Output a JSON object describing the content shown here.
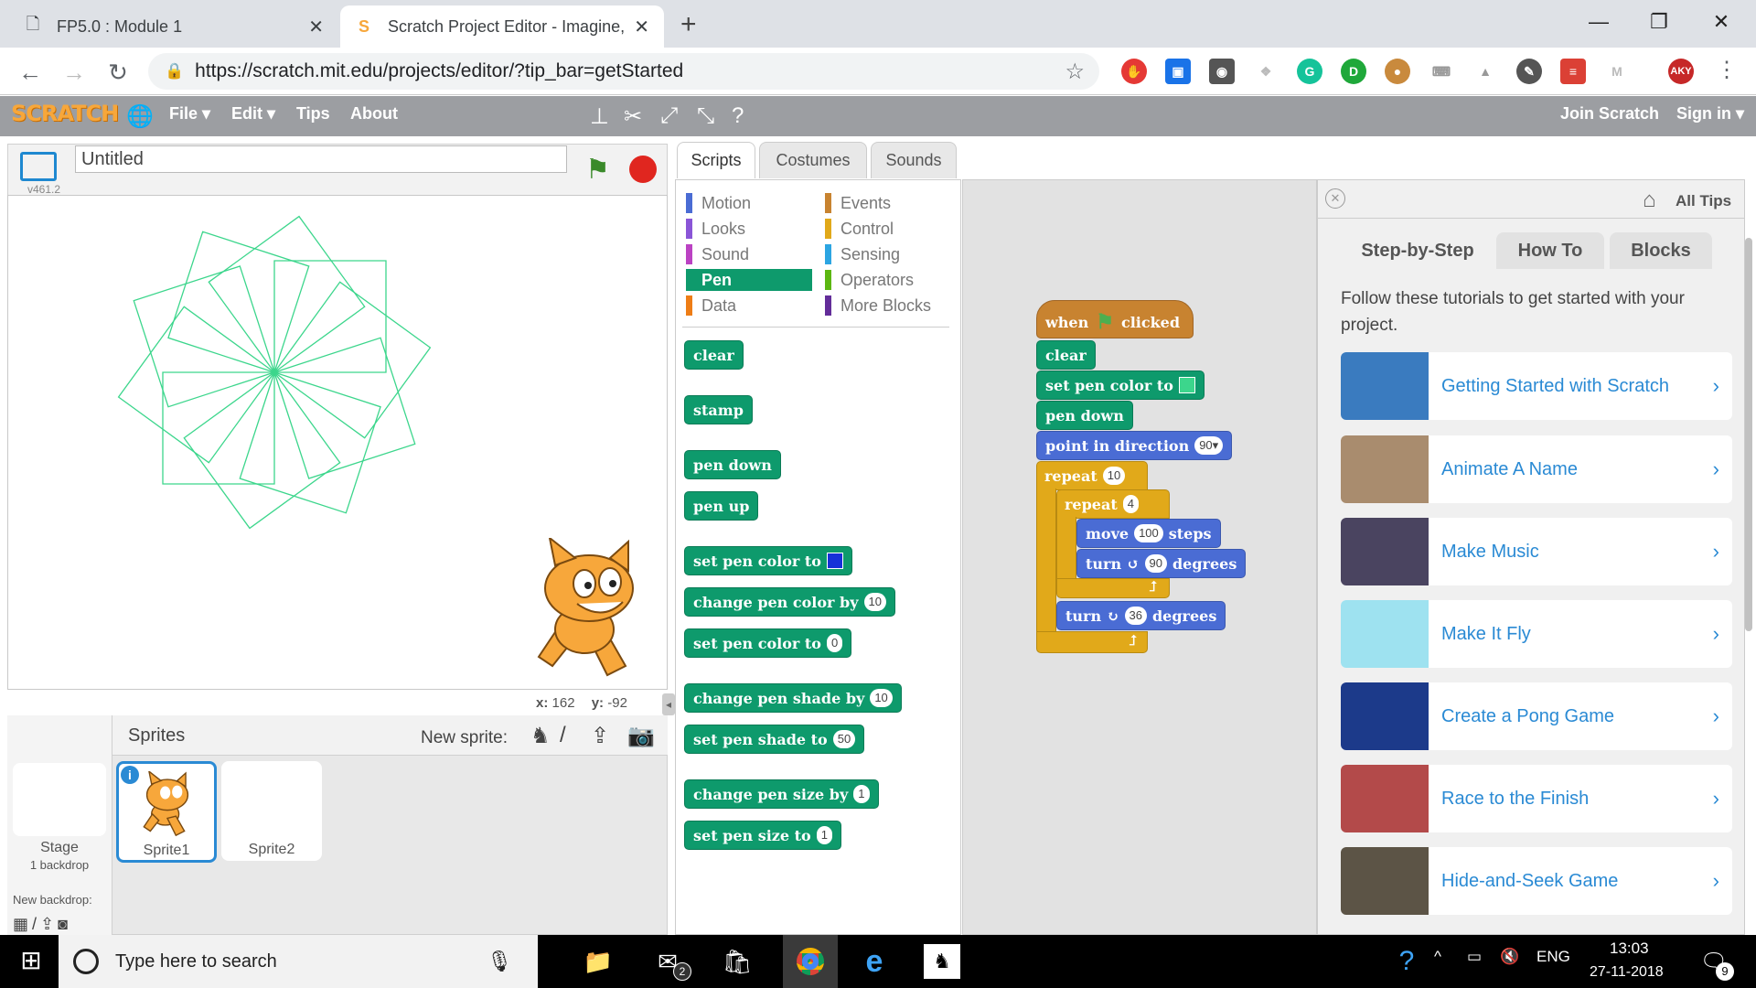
{
  "browser": {
    "tabs": [
      {
        "title": "FP5.0 : Module 1",
        "icon": "document-icon"
      },
      {
        "title": "Scratch Project Editor - Imagine,",
        "icon": "scratch-favicon-icon"
      }
    ],
    "url": "https://scratch.mit.edu/projects/editor/?tip_bar=getStarted",
    "extensions": [
      "adblock-icon",
      "screenshot-icon",
      "bulb-icon",
      "dropbox-icon",
      "grammarly-icon",
      "dashlane-icon",
      "cookie-icon",
      "keyboard-icon",
      "drive-icon",
      "feather-icon",
      "todoist-icon",
      "gmail-icon",
      "profile-avatar-icon"
    ],
    "avatar_text": "AKY"
  },
  "scratch_menu": {
    "logo": "SCRATCH",
    "items": [
      "File ▾",
      "Edit ▾",
      "Tips",
      "About"
    ],
    "join": "Join Scratch",
    "signin": "Sign in ▾"
  },
  "stage": {
    "title": "Untitled",
    "version": "v461.2",
    "x_label": "x:",
    "x_value": "162",
    "y_label": "y:",
    "y_value": "-92",
    "line_color": "#3cd68c"
  },
  "sprites": {
    "header": "Sprites",
    "new_sprite_label": "New sprite:",
    "stage_label": "Stage",
    "stage_sub": "1 backdrop",
    "new_backdrop": "New backdrop:",
    "items": [
      "Sprite1",
      "Sprite2"
    ]
  },
  "editor_tabs": [
    "Scripts",
    "Costumes",
    "Sounds"
  ],
  "categories": {
    "left": [
      {
        "name": "Motion",
        "color": "#4a6cd4"
      },
      {
        "name": "Looks",
        "color": "#8a55d7"
      },
      {
        "name": "Sound",
        "color": "#bb42c3"
      },
      {
        "name": "Pen",
        "color": "#0e9a6c"
      },
      {
        "name": "Data",
        "color": "#ee7d16"
      }
    ],
    "right": [
      {
        "name": "Events",
        "color": "#c88330"
      },
      {
        "name": "Control",
        "color": "#e1a91a"
      },
      {
        "name": "Sensing",
        "color": "#2ca5e2"
      },
      {
        "name": "Operators",
        "color": "#5cb712"
      },
      {
        "name": "More Blocks",
        "color": "#632d99"
      }
    ]
  },
  "palette_blocks": {
    "clear": "clear",
    "stamp": "stamp",
    "pen_down": "pen down",
    "pen_up": "pen up",
    "set_color": "set pen color to",
    "change_color": "change pen color by",
    "change_color_val": "10",
    "set_color_num": "set pen color to",
    "set_color_num_val": "0",
    "change_shade": "change pen shade by",
    "change_shade_val": "10",
    "set_shade": "set pen shade to",
    "set_shade_val": "50",
    "change_size": "change pen size by",
    "change_size_val": "1",
    "set_size": "set pen size to",
    "set_size_val": "1"
  },
  "script": {
    "when": "when",
    "clicked": "clicked",
    "clear": "clear",
    "set_color": "set pen color to",
    "pen_down": "pen down",
    "point": "point in direction",
    "point_val": "90▾",
    "repeat_outer": "repeat",
    "repeat_outer_val": "10",
    "repeat_inner": "repeat",
    "repeat_inner_val": "4",
    "move": "move",
    "move_val": "100",
    "move_unit": "steps",
    "turn1": "turn",
    "turn1_val": "90",
    "turn1_unit": "degrees",
    "turn2": "turn",
    "turn2_val": "36",
    "turn2_unit": "degrees"
  },
  "tips": {
    "all_tips": "All Tips",
    "tabs": [
      "Step-by-Step",
      "How To",
      "Blocks"
    ],
    "intro": "Follow these tutorials to get started with your project.",
    "cards": [
      {
        "label": "Getting Started with Scratch",
        "color": "#3a7bbf"
      },
      {
        "label": "Animate A Name",
        "color": "#a98c6e"
      },
      {
        "label": "Make Music",
        "color": "#4a4460"
      },
      {
        "label": "Make It Fly",
        "color": "#9ee2f0"
      },
      {
        "label": "Create a Pong Game",
        "color": "#1c3a8a"
      },
      {
        "label": "Race to the Finish",
        "color": "#b34a4a"
      },
      {
        "label": "Hide-and-Seek Game",
        "color": "#5c5446"
      }
    ]
  },
  "taskbar": {
    "search_placeholder": "Type here to search",
    "lang": "ENG",
    "time": "13:03",
    "date": "27-11-2018",
    "mail_badge": "2",
    "notif_badge": "9"
  }
}
